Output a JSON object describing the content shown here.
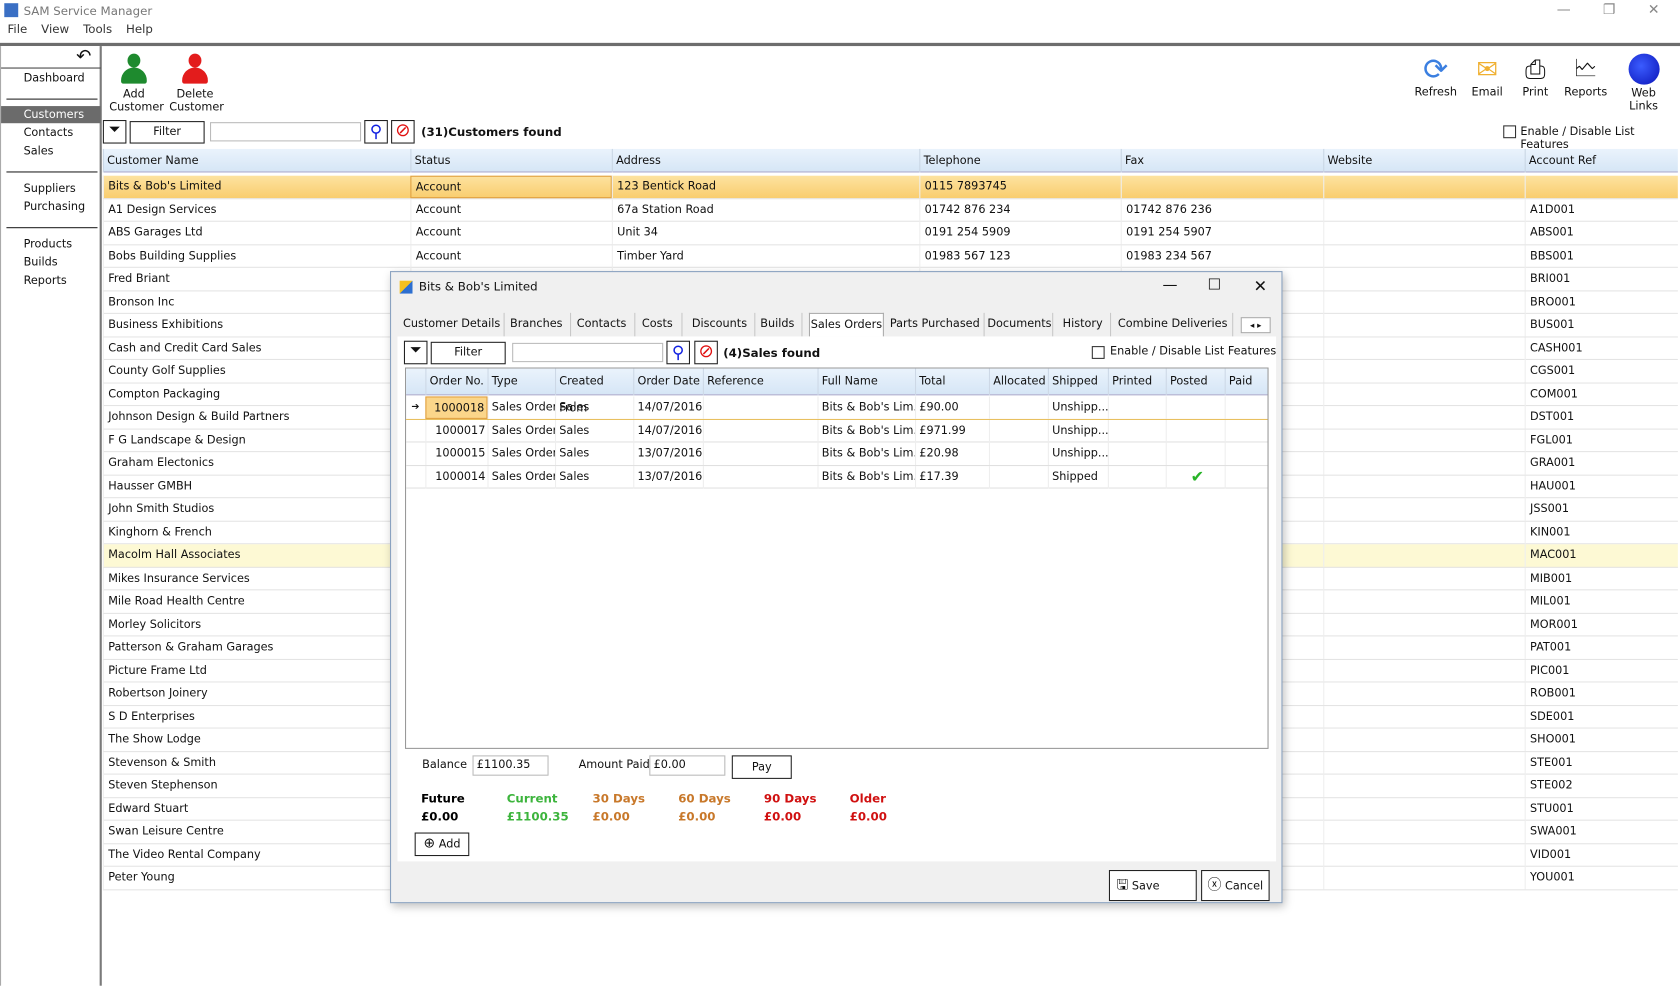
{
  "app": {
    "title": "SAM Service Manager"
  },
  "menu": [
    "File",
    "View",
    "Tools",
    "Help"
  ],
  "sidebar": {
    "items": [
      "Dashboard",
      "Customers",
      "Contacts",
      "Sales",
      "Suppliers",
      "Purchasing",
      "Products",
      "Builds",
      "Reports"
    ],
    "active": "Customers"
  },
  "toolbar": {
    "add": [
      "Add",
      "Customer"
    ],
    "delete": [
      "Delete",
      "Customer"
    ],
    "refresh": "Refresh",
    "email": "Email",
    "print": "Print",
    "reports": "Reports",
    "weblinks": "Web Links"
  },
  "filter": {
    "button": "Filter",
    "search_value": "",
    "count_text": "(31)Customers found",
    "list_features": "Enable / Disable List Features"
  },
  "grid": {
    "columns": [
      "Customer Name",
      "Status",
      "Address",
      "Telephone",
      "Fax",
      "Website",
      "Account Ref"
    ],
    "rows": [
      [
        "Bits & Bob's Limited",
        "Account",
        "123 Bentick Road",
        "0115 7893745",
        "",
        "",
        ""
      ],
      [
        "A1 Design Services",
        "Account",
        "67a Station Road",
        "01742 876 234",
        "01742 876 236",
        "",
        "A1D001"
      ],
      [
        "ABS Garages Ltd",
        "Account",
        "Unit 34",
        "0191 254 5909",
        "0191 254 5907",
        "",
        "ABS001"
      ],
      [
        "Bobs Building Supplies",
        "Account",
        "Timber Yard",
        "01983 567 123",
        "01983 234 567",
        "",
        "BBS001"
      ],
      [
        "Fred Briant",
        "",
        "",
        "",
        "",
        "",
        "BRI001"
      ],
      [
        "Bronson Inc",
        "",
        "",
        "",
        "",
        "",
        "BRO001"
      ],
      [
        "Business Exhibitions",
        "",
        "",
        "",
        "",
        "",
        "BUS001"
      ],
      [
        "Cash and Credit Card Sales",
        "",
        "",
        "",
        "",
        "",
        "CASH001"
      ],
      [
        "County Golf Supplies",
        "",
        "",
        "",
        "",
        "",
        "CGS001"
      ],
      [
        "Compton Packaging",
        "",
        "",
        "",
        "",
        "",
        "COM001"
      ],
      [
        "Johnson Design & Build Partners",
        "",
        "",
        "",
        "",
        "",
        "DST001"
      ],
      [
        "F G Landscape & Design",
        "",
        "",
        "",
        "",
        "",
        "FGL001"
      ],
      [
        "Graham Electonics",
        "",
        "",
        "",
        "",
        "",
        "GRA001"
      ],
      [
        "Hausser GMBH",
        "",
        "",
        "",
        "",
        "",
        "HAU001"
      ],
      [
        "John Smith Studios",
        "",
        "",
        "",
        "",
        "",
        "JSS001"
      ],
      [
        "Kinghorn & French",
        "",
        "",
        "",
        "",
        "",
        "KIN001"
      ],
      [
        "Macolm Hall Associates",
        "",
        "",
        "",
        "",
        "",
        "MAC001"
      ],
      [
        "Mikes Insurance Services",
        "",
        "",
        "",
        "",
        "",
        "MIB001"
      ],
      [
        "Mile Road Health Centre",
        "",
        "",
        "",
        "",
        "",
        "MIL001"
      ],
      [
        "Morley Solicitors",
        "",
        "",
        "",
        "",
        "",
        "MOR001"
      ],
      [
        "Patterson & Graham Garages",
        "",
        "",
        "",
        "",
        "",
        "PAT001"
      ],
      [
        "Picture Frame Ltd",
        "",
        "",
        "",
        "",
        "",
        "PIC001"
      ],
      [
        "Robertson Joinery",
        "",
        "",
        "",
        "",
        "",
        "ROB001"
      ],
      [
        "S D Enterprises",
        "",
        "",
        "",
        "",
        "",
        "SDE001"
      ],
      [
        "The Show Lodge",
        "",
        "",
        "",
        "",
        "",
        "SHO001"
      ],
      [
        "Stevenson & Smith",
        "",
        "",
        "",
        "",
        "",
        "STE001"
      ],
      [
        "Steven Stephenson",
        "",
        "",
        "",
        "",
        "",
        "STE002"
      ],
      [
        "Edward Stuart",
        "",
        "",
        "",
        "",
        "",
        "STU001"
      ],
      [
        "Swan Leisure Centre",
        "",
        "",
        "",
        "",
        "",
        "SWA001"
      ],
      [
        "The Video Rental Company",
        "",
        "",
        "",
        "",
        "",
        "VID001"
      ],
      [
        "Peter Young",
        "",
        "",
        "",
        "",
        "",
        "YOU001"
      ]
    ]
  },
  "dialog": {
    "title": "Bits & Bob's Limited",
    "tabs": [
      "Customer Details",
      "Branches",
      "Contacts",
      "Costs",
      "Discounts",
      "Builds",
      "Sales Orders",
      "Parts Purchased",
      "Documents",
      "History",
      "Combine Deliveries"
    ],
    "active_tab": "Sales Orders",
    "filter": "Filter",
    "search_value": "",
    "count_text": "(4)Sales found",
    "list_features": "Enable / Disable List Features",
    "columns": [
      "Order No.",
      "Type",
      "Created From",
      "Order Date",
      "Reference",
      "Full Name",
      "Total",
      "Allocated",
      "Shipped",
      "Printed",
      "Posted",
      "Paid"
    ],
    "rows": [
      {
        "order": "1000018",
        "type": "Sales Order",
        "from": "Sales",
        "date": "14/07/2016",
        "ref": "",
        "name": "Bits & Bob's Lim...",
        "total": "£90.00",
        "alloc": "",
        "shipped": "Unshipp...",
        "printed": "",
        "posted": false,
        "paid": ""
      },
      {
        "order": "1000017",
        "type": "Sales Order",
        "from": "Sales",
        "date": "14/07/2016",
        "ref": "",
        "name": "Bits & Bob's Lim...",
        "total": "£971.99",
        "alloc": "",
        "shipped": "Unshipp...",
        "printed": "",
        "posted": false,
        "paid": ""
      },
      {
        "order": "1000015",
        "type": "Sales Order",
        "from": "Sales",
        "date": "13/07/2016",
        "ref": "",
        "name": "Bits & Bob's Lim...",
        "total": "£20.98",
        "alloc": "",
        "shipped": "Unshipp...",
        "printed": "",
        "posted": false,
        "paid": ""
      },
      {
        "order": "1000014",
        "type": "Sales Order",
        "from": "Sales",
        "date": "13/07/2016",
        "ref": "",
        "name": "Bits & Bob's Lim...",
        "total": "£17.39",
        "alloc": "",
        "shipped": "Shipped",
        "printed": "",
        "posted": true,
        "paid": ""
      }
    ],
    "balance_label": "Balance",
    "balance": "£1100.35",
    "amount_paid_label": "Amount Paid",
    "amount_paid": "£0.00",
    "pay": "Pay",
    "aging": [
      {
        "label": "Future",
        "value": "£0.00",
        "color": "#000000"
      },
      {
        "label": "Current",
        "value": "£1100.35",
        "color": "#3cb43c"
      },
      {
        "label": "30 Days",
        "value": "£0.00",
        "color": "#c8782a"
      },
      {
        "label": "60 Days",
        "value": "£0.00",
        "color": "#c8782a"
      },
      {
        "label": "90 Days",
        "value": "£0.00",
        "color": "#d01010"
      },
      {
        "label": "Older",
        "value": "£0.00",
        "color": "#d01010"
      }
    ],
    "add": "Add",
    "save": "Save",
    "cancel": "Cancel"
  }
}
